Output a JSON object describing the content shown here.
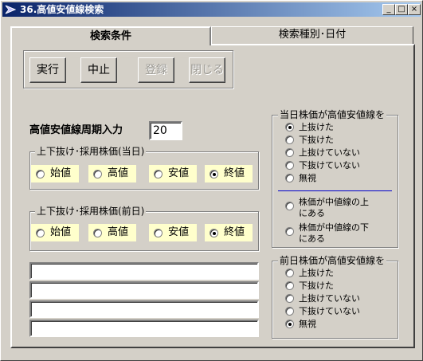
{
  "window": {
    "title": "36.高値安値線検索",
    "min_label": "_",
    "max_label": "□",
    "close_label": "×"
  },
  "tabs": [
    {
      "label": "検索条件"
    },
    {
      "label": "検索種別･日付"
    }
  ],
  "buttons": {
    "run": "実行",
    "stop": "中止",
    "register": "登録",
    "close": "閉じる"
  },
  "period": {
    "label": "高値安値線周期入力",
    "value": "20"
  },
  "group_today": {
    "legend": "上下抜け･採用株価(当日)",
    "options": [
      {
        "label": "始値",
        "checked": false
      },
      {
        "label": "高値",
        "checked": false
      },
      {
        "label": "安値",
        "checked": false
      },
      {
        "label": "終値",
        "checked": true
      }
    ]
  },
  "group_prev": {
    "legend": "上下抜け･採用株価(前日)",
    "options": [
      {
        "label": "始値",
        "checked": false
      },
      {
        "label": "高値",
        "checked": false
      },
      {
        "label": "安値",
        "checked": false
      },
      {
        "label": "終値",
        "checked": true
      }
    ]
  },
  "today_vs_line": {
    "legend": "当日株価が高値安値線を",
    "options": [
      {
        "label": "上抜けた",
        "checked": true
      },
      {
        "label": "下抜けた",
        "checked": false
      },
      {
        "label": "上抜けていない",
        "checked": false
      },
      {
        "label": "下抜けていない",
        "checked": false
      },
      {
        "label": "無視",
        "checked": false
      }
    ],
    "extra_options": [
      {
        "line1": "株価が中値線の上",
        "line2": "にある",
        "checked": false
      },
      {
        "line1": "株価が中値線の下",
        "line2": "にある",
        "checked": false
      }
    ]
  },
  "prev_vs_line": {
    "legend": "前日株価が高値安値線を",
    "options": [
      {
        "label": "上抜けた",
        "checked": false
      },
      {
        "label": "下抜けた",
        "checked": false
      },
      {
        "label": "上抜けていない",
        "checked": false
      },
      {
        "label": "下抜けていない",
        "checked": false
      },
      {
        "label": "無視",
        "checked": true
      }
    ]
  },
  "colors": {
    "title_start": "#0a246a",
    "title_end": "#a6caf0",
    "option_bg": "#ffffcc",
    "divider": "#0000cc"
  }
}
